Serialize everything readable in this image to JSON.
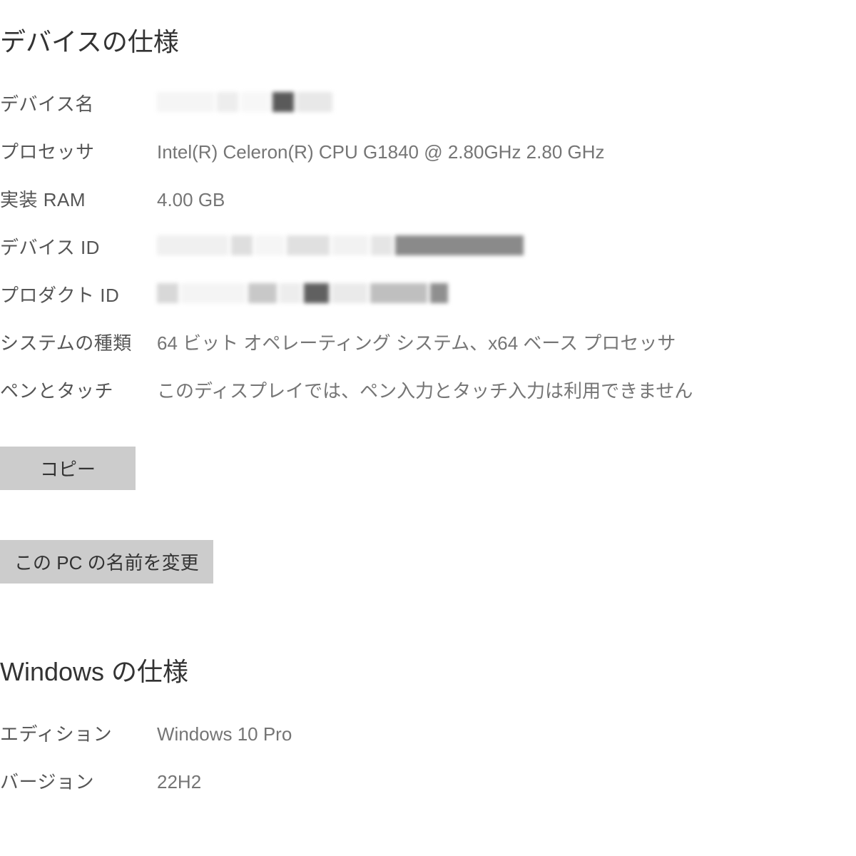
{
  "device_spec": {
    "heading": "デバイスの仕様",
    "rows": {
      "device_name": {
        "label": "デバイス名"
      },
      "processor": {
        "label": "プロセッサ",
        "value": "Intel(R) Celeron(R) CPU G1840 @ 2.80GHz   2.80 GHz"
      },
      "ram": {
        "label": "実装 RAM",
        "value": "4.00 GB"
      },
      "device_id": {
        "label": "デバイス ID"
      },
      "product_id": {
        "label": "プロダクト ID"
      },
      "system_type": {
        "label": "システムの種類",
        "value": "64 ビット オペレーティング システム、x64 ベース プロセッサ"
      },
      "pen_touch": {
        "label": "ペンとタッチ",
        "value": "このディスプレイでは、ペン入力とタッチ入力は利用できません"
      }
    },
    "copy_button": "コピー",
    "rename_button": "この PC の名前を変更"
  },
  "windows_spec": {
    "heading": "Windows の仕様",
    "rows": {
      "edition": {
        "label": "エディション",
        "value": "Windows 10 Pro"
      },
      "version": {
        "label": "バージョン",
        "value": "22H2"
      }
    }
  }
}
